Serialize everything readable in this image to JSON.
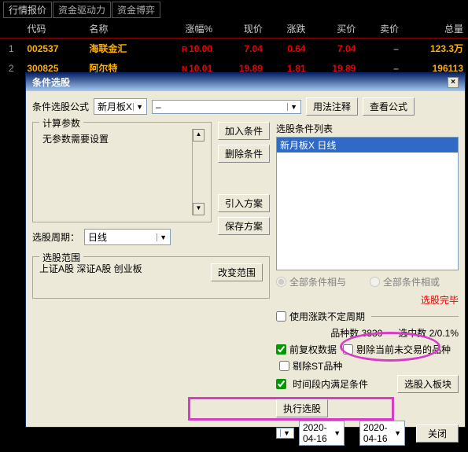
{
  "top_tabs": {
    "t0": "行情报价",
    "t1": "资金驱动力",
    "t2": "资金博弈"
  },
  "table": {
    "headers": {
      "h0": "",
      "h1": "代码",
      "h2": "名称",
      "h3": "涨幅%",
      "h4": "现价",
      "h5": "涨跌",
      "h6": "买价",
      "h7": "卖价",
      "h8": "总量"
    },
    "rows": [
      {
        "idx": "1",
        "code": "002537",
        "name": "海联金汇",
        "prefix": "R",
        "chg": "10.00",
        "price": "7.04",
        "diff": "0.64",
        "bid": "7.04",
        "ask": "–",
        "vol": "123.3万"
      },
      {
        "idx": "2",
        "code": "300825",
        "name": "阿尔特",
        "prefix": "N",
        "chg": "10.01",
        "price": "19.89",
        "diff": "1.81",
        "bid": "19.89",
        "ask": "–",
        "vol": "196113"
      }
    ]
  },
  "dialog": {
    "title": "条件选股",
    "formula_label": "条件选股公式",
    "formula_value": "新月板X",
    "formula_sub": "–",
    "btn_usage": "用法注释",
    "btn_view": "查看公式",
    "calc_legend": "计算参数",
    "calc_text": "无参数需要设置",
    "period_label": "选股周期：",
    "period_value": "日线",
    "range_legend": "选股范围",
    "range_text": "上证A股 深证A股 创业板",
    "btn_change_range": "改变范围",
    "btn_add": "加入条件",
    "btn_del": "删除条件",
    "btn_import": "引入方案",
    "btn_save": "保存方案",
    "list_legend": "选股条件列表",
    "list_item": "新月板X  日线",
    "radio_and": "全部条件相与",
    "radio_or": "全部条件相或",
    "status": "选股完毕",
    "chk_uncertain": "使用涨跌不定周期",
    "count_label": "品种数 3830",
    "selected_label": "选中数 2/0.1%",
    "chk_fq": "前复权数据",
    "chk_notrade": "剔除当前未交易的品种",
    "chk_st": "剔除ST品种",
    "chk_time": "时间段内满足条件",
    "btn_into": "选股入板块",
    "btn_exec": "执行选股",
    "date_from": "2020-04-16",
    "date_sep": "–",
    "date_to": "2020-04-16",
    "btn_close": "关闭"
  }
}
